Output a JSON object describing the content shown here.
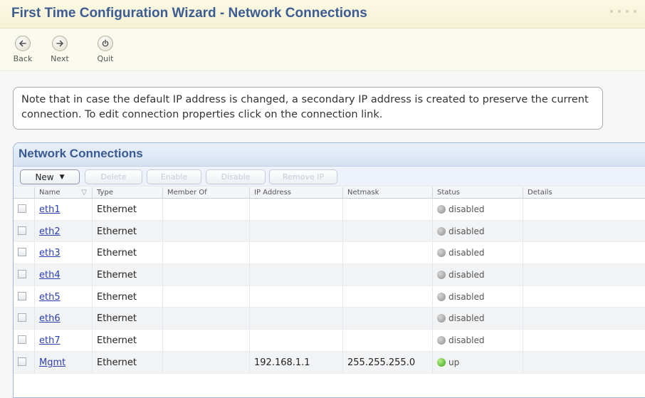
{
  "window": {
    "title": "First Time Configuration Wizard - Network Connections"
  },
  "toolbar": {
    "back_label": "Back",
    "next_label": "Next",
    "quit_label": "Quit"
  },
  "note": "Note that in case the default IP address is changed, a secondary IP address is created to preserve the current connection. To edit connection properties click on the connection link.",
  "panel": {
    "title": "Network Connections",
    "buttons": {
      "new": "New",
      "delete": "Delete",
      "enable": "Enable",
      "disable": "Disable",
      "remove_ip": "Remove IP"
    }
  },
  "table": {
    "columns": {
      "name": "Name",
      "type": "Type",
      "member_of": "Member Of",
      "ip_address": "IP Address",
      "netmask": "Netmask",
      "status": "Status",
      "details": "Details"
    },
    "rows": [
      {
        "name": "eth1",
        "type": "Ethernet",
        "member_of": "",
        "ip": "",
        "netmask": "",
        "status": "disabled",
        "details": ""
      },
      {
        "name": "eth2",
        "type": "Ethernet",
        "member_of": "",
        "ip": "",
        "netmask": "",
        "status": "disabled",
        "details": ""
      },
      {
        "name": "eth3",
        "type": "Ethernet",
        "member_of": "",
        "ip": "",
        "netmask": "",
        "status": "disabled",
        "details": ""
      },
      {
        "name": "eth4",
        "type": "Ethernet",
        "member_of": "",
        "ip": "",
        "netmask": "",
        "status": "disabled",
        "details": ""
      },
      {
        "name": "eth5",
        "type": "Ethernet",
        "member_of": "",
        "ip": "",
        "netmask": "",
        "status": "disabled",
        "details": ""
      },
      {
        "name": "eth6",
        "type": "Ethernet",
        "member_of": "",
        "ip": "",
        "netmask": "",
        "status": "disabled",
        "details": ""
      },
      {
        "name": "eth7",
        "type": "Ethernet",
        "member_of": "",
        "ip": "",
        "netmask": "",
        "status": "disabled",
        "details": ""
      },
      {
        "name": "Mgmt",
        "type": "Ethernet",
        "member_of": "",
        "ip": "192.168.1.1",
        "netmask": "255.255.255.0",
        "status": "up",
        "details": ""
      }
    ]
  },
  "colors": {
    "title": "#3d5c92",
    "panel_title": "#3a5a92",
    "link": "#2b3fb0",
    "status_up": "#3aa51a",
    "status_disabled": "#8e8e8e"
  }
}
